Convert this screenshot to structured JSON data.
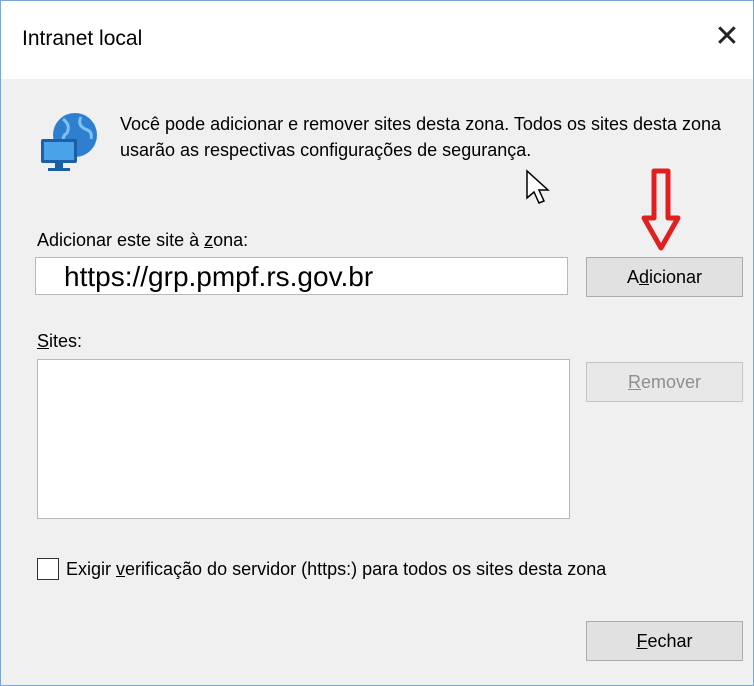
{
  "window": {
    "title": "Intranet local",
    "close_glyph": "✕"
  },
  "info": {
    "icon": "globe-computer-icon",
    "description": "Você pode adicionar e remover sites desta zona. Todos os sites desta zona usarão as respectivas configurações de segurança."
  },
  "add_site": {
    "label_before": "Adicionar este site à ",
    "label_accel": "z",
    "label_after": "ona:",
    "value": "https://grp.pmpf.rs.gov.br",
    "button_before": "A",
    "button_accel": "d",
    "button_after": "icionar"
  },
  "sites": {
    "label_accel": "S",
    "label_after": "ites:",
    "items": [],
    "remove_accel": "R",
    "remove_after": "emover"
  },
  "require_https": {
    "before": "Exigir ",
    "accel": "v",
    "after": "erificação do servidor (https:) para todos os sites desta zona",
    "checked": false
  },
  "footer": {
    "close_accel": "F",
    "close_after": "echar"
  },
  "colors": {
    "annotation_arrow": "#e02020",
    "window_border": "#7aa7d8"
  }
}
